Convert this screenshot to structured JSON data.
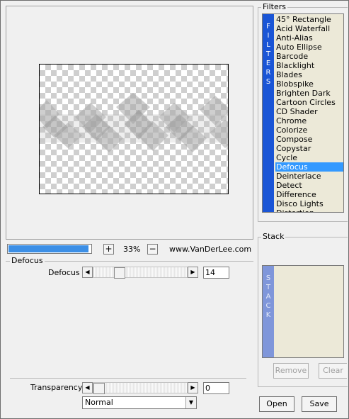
{
  "zoom": {
    "minus": "−",
    "plus": "+",
    "level": "33%"
  },
  "website": "www.VanDerLee.com",
  "progress": {
    "fraction": 0.97
  },
  "filters": {
    "group_label": "Filters",
    "band_letters": [
      "F",
      "I",
      "L",
      "T",
      "E",
      "R",
      "S"
    ],
    "items": [
      "45° Rectangle",
      "Acid Waterfall",
      "Anti-Alias",
      "Auto Ellipse",
      "Barcode",
      "Blacklight",
      "Blades",
      "Blobspike",
      "Brighten Dark",
      "Cartoon Circles",
      "CD Shader",
      "Chrome",
      "Colorize",
      "Compose",
      "Copystar",
      "Cycle",
      "Defocus",
      "Deinterlace",
      "Detect",
      "Difference",
      "Disco Lights",
      "Distortion"
    ],
    "selected": "Defocus"
  },
  "defocus": {
    "group_label": "Defocus",
    "param_label": "Defocus",
    "value": "14",
    "slider_fraction": 0.25
  },
  "stack": {
    "group_label": "Stack",
    "band_letters": [
      "S",
      "T",
      "A",
      "C",
      "K"
    ],
    "remove_label": "Remove",
    "clear_label": "Clear"
  },
  "transparency": {
    "label": "Transparency",
    "value": "0",
    "slider_fraction": 0.0
  },
  "blend_mode": {
    "selected": "Normal"
  },
  "buttons": {
    "open_label": "Open",
    "save_label": "Save"
  },
  "icons": {
    "arrow_left": "◀",
    "arrow_right": "▶",
    "dropdown": "▼"
  }
}
